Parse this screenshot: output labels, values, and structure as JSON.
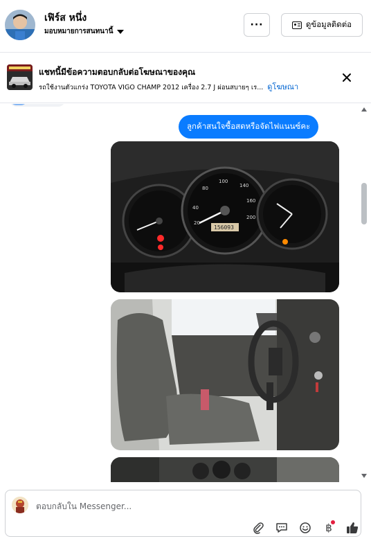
{
  "header": {
    "name": "เฟิร์ส หนึ่ง",
    "assign_label": "มอบหมายการสนทนานี้",
    "more_label": "···",
    "contact_label": "ดูข้อมูลติดต่อ"
  },
  "ad": {
    "title": "แชทนี้มีข้อความตอบกลับต่อโฆษณาของคุณ",
    "subtitle": "รถใช้งานตัวแกร่ง TOYOTA VIGO CHAMP 2012 เครื่อง 2.7 J ผ่อนสบายๆ เร...",
    "link_label": "ดูโฆษณา"
  },
  "chat": {
    "message": "ลูกค้าสนใจซื้อสดหรือจัดไฟแนนซ์คะ",
    "odometer": "156093"
  },
  "composer": {
    "placeholder": "ตอบกลับใน Messenger...",
    "baht_symbol": "฿"
  },
  "icons": [
    "more-icon",
    "contact-card-icon",
    "close-icon",
    "attach-icon",
    "saved-reply-icon",
    "emoji-icon",
    "baht-icon",
    "like-icon"
  ],
  "colors": {
    "accent": "#0a7cff",
    "link": "#0064d1",
    "notification": "#e41e3f"
  }
}
